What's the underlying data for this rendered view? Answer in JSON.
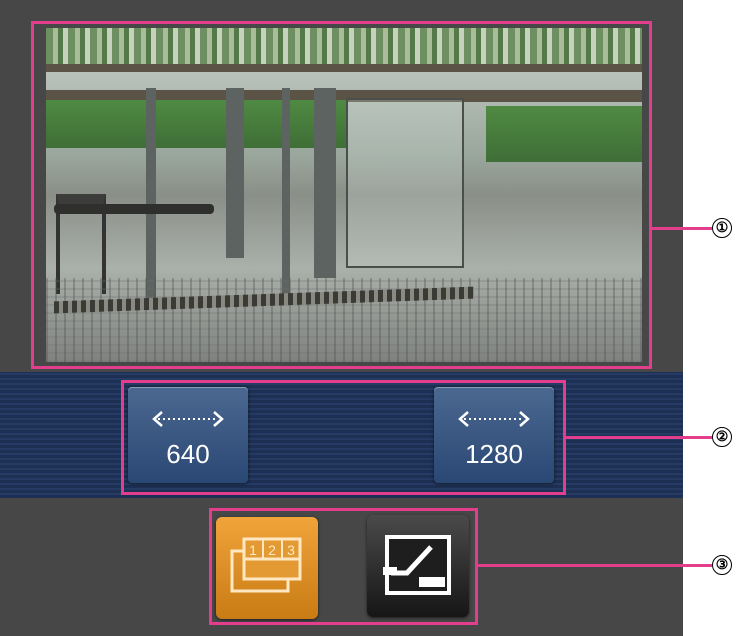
{
  "resolution_buttons": [
    {
      "label": "640",
      "icon": "width-arrows-icon"
    },
    {
      "label": "1280",
      "icon": "width-arrows-icon"
    }
  ],
  "bottom_buttons": {
    "multi_screen": {
      "icon": "multi-screen-icon",
      "digits": [
        "1",
        "2",
        "3"
      ],
      "color": "#e8962a"
    },
    "display_mode": {
      "icon": "display-mode-icon",
      "color": "#2a2a2a"
    }
  },
  "callouts": [
    "①",
    "②",
    "③"
  ],
  "colors": {
    "panel": "#474747",
    "band": "#1f3156",
    "callout": "#e33d8e"
  }
}
